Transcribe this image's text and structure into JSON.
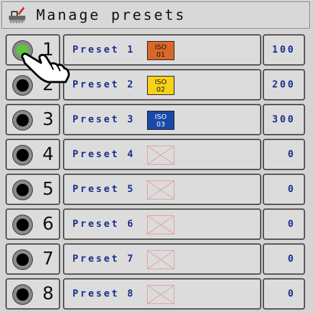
{
  "header": {
    "title": "Manage presets",
    "icon": "spreader-icon"
  },
  "presets": [
    {
      "number": "1",
      "label": "Preset 1",
      "iso_line1": "ISO",
      "iso_line2": "01",
      "iso_color": "#d9682a",
      "value": "100",
      "active": true
    },
    {
      "number": "2",
      "label": "Preset 2",
      "iso_line1": "ISO",
      "iso_line2": "02",
      "iso_color": "#f7d21a",
      "value": "200",
      "active": false
    },
    {
      "number": "3",
      "label": "Preset 3",
      "iso_line1": "ISO",
      "iso_line2": "03",
      "iso_color": "#1848a8",
      "value": "300",
      "active": false
    },
    {
      "number": "4",
      "label": "Preset 4",
      "iso_line1": "",
      "iso_line2": "",
      "iso_color": "",
      "value": "0",
      "active": false
    },
    {
      "number": "5",
      "label": "Preset 5",
      "iso_line1": "",
      "iso_line2": "",
      "iso_color": "",
      "value": "0",
      "active": false
    },
    {
      "number": "6",
      "label": "Preset 6",
      "iso_line1": "",
      "iso_line2": "",
      "iso_color": "",
      "value": "0",
      "active": false
    },
    {
      "number": "7",
      "label": "Preset 7",
      "iso_line1": "",
      "iso_line2": "",
      "iso_color": "",
      "value": "0",
      "active": false
    },
    {
      "number": "8",
      "label": "Preset 8",
      "iso_line1": "",
      "iso_line2": "",
      "iso_color": "",
      "value": "0",
      "active": false
    }
  ],
  "colors": {
    "text_blue": "#1a2f8c",
    "active_indicator": "#5bc63a"
  }
}
